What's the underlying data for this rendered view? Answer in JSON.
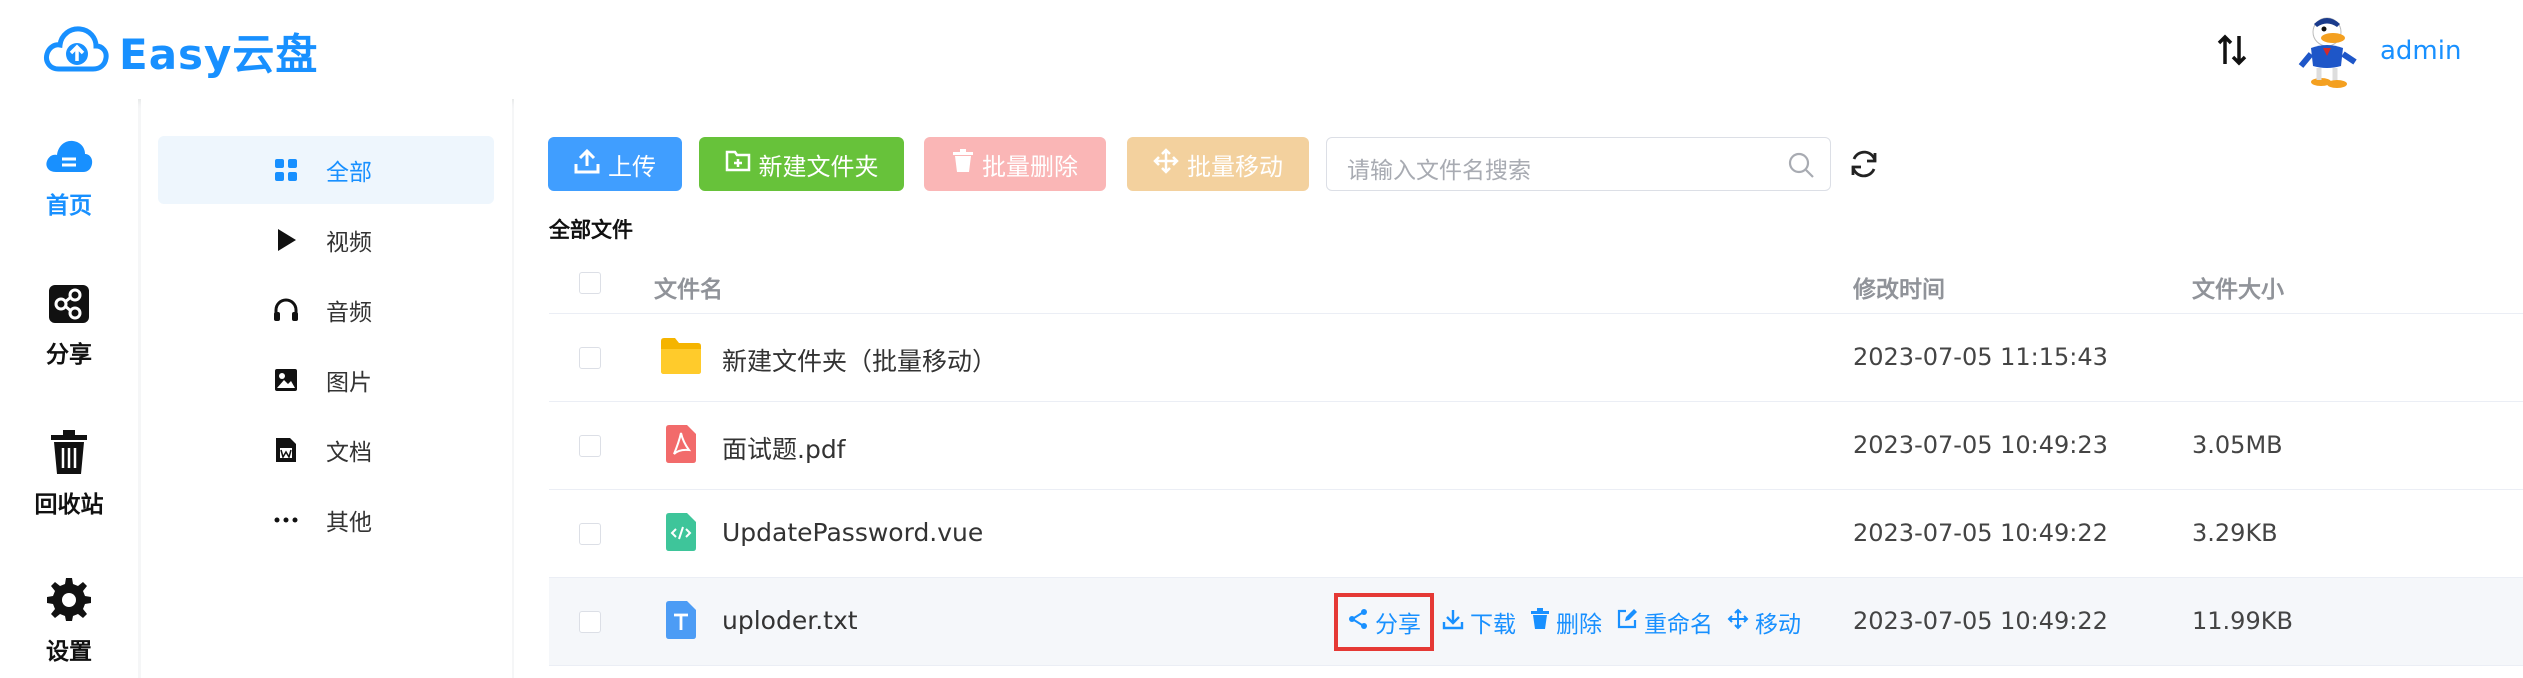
{
  "app": {
    "logo_text": "Easy云盘"
  },
  "header": {
    "username": "admin"
  },
  "sidebar": {
    "items": [
      {
        "label": "首页",
        "icon": "cloud-home-icon",
        "active": true
      },
      {
        "label": "分享",
        "icon": "share-icon",
        "active": false
      },
      {
        "label": "回收站",
        "icon": "trash-icon",
        "active": false
      },
      {
        "label": "设置",
        "icon": "gear-icon",
        "active": false
      }
    ]
  },
  "categories": [
    {
      "label": "全部",
      "icon": "grid-icon",
      "active": true
    },
    {
      "label": "视频",
      "icon": "play-icon",
      "active": false
    },
    {
      "label": "音频",
      "icon": "headphones-icon",
      "active": false
    },
    {
      "label": "图片",
      "icon": "image-icon",
      "active": false
    },
    {
      "label": "文档",
      "icon": "document-icon",
      "active": false
    },
    {
      "label": "其他",
      "icon": "more-icon",
      "active": false
    }
  ],
  "toolbar": {
    "upload": "上传",
    "new_folder": "新建文件夹",
    "batch_delete": "批量删除",
    "batch_move": "批量移动",
    "search_placeholder": "请输入文件名搜索"
  },
  "breadcrumb": "全部文件",
  "table": {
    "headers": {
      "name": "文件名",
      "modified": "修改时间",
      "size": "文件大小"
    },
    "rows": [
      {
        "name": "新建文件夹（批量移动）",
        "type": "folder",
        "modified": "2023-07-05 11:15:43",
        "size": ""
      },
      {
        "name": "面试题.pdf",
        "type": "pdf",
        "modified": "2023-07-05 10:49:23",
        "size": "3.05MB"
      },
      {
        "name": "UpdatePassword.vue",
        "type": "code",
        "modified": "2023-07-05 10:49:22",
        "size": "3.29KB"
      },
      {
        "name": "uploder.txt",
        "type": "txt",
        "modified": "2023-07-05 10:49:22",
        "size": "11.99KB"
      }
    ],
    "row_actions": {
      "share": "分享",
      "download": "下载",
      "delete": "删除",
      "rename": "重命名",
      "move": "移动"
    }
  },
  "colors": {
    "primary": "#1890ff",
    "upload": "#409eff",
    "new_folder": "#67c23a",
    "batch_delete": "#fab6b6",
    "batch_move": "#f3d19e",
    "highlight_box": "#e53935"
  }
}
